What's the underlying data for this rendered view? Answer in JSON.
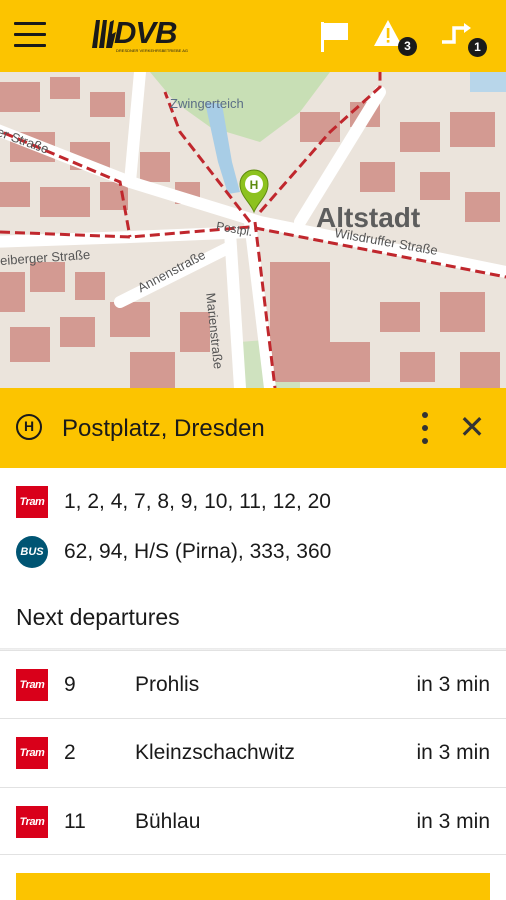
{
  "header": {
    "logo_text": "DVB",
    "logo_subtitle": "DRESDNER VERKEHRSBETRIEBE AG",
    "alerts_count": "3",
    "routes_count": "1"
  },
  "map": {
    "labels": {
      "district": "Altstadt",
      "zwingerteich": "Zwingerteich",
      "street_top_left": "er Straße",
      "postplatz": "Postpl.",
      "wilsdruffer": "Wilsdruffer Straße",
      "freiberger": "eiberger Straße",
      "annenstrasse": "Annenstraße",
      "marienstrasse": "Marienstraße"
    },
    "marker_letter": "H"
  },
  "stop": {
    "icon_letter": "H",
    "name": "Postplatz, Dresden"
  },
  "lines": [
    {
      "type": "tram",
      "badge": "Tram",
      "numbers": "1, 2, 4, 7, 8, 9, 10, 11, 12, 20"
    },
    {
      "type": "bus",
      "badge": "BUS",
      "numbers": "62, 94, H/S (Pirna), 333, 360"
    }
  ],
  "departures_title": "Next departures",
  "departures": [
    {
      "badge": "Tram",
      "line": "9",
      "destination": "Prohlis",
      "time": "in 3 min"
    },
    {
      "badge": "Tram",
      "line": "2",
      "destination": "Kleinzschachwitz",
      "time": "in 3 min"
    },
    {
      "badge": "Tram",
      "line": "11",
      "destination": "Bühlau",
      "time": "in 3 min"
    }
  ],
  "colors": {
    "brand_yellow": "#fcc400",
    "tram_red": "#d9001a",
    "bus_teal": "#005573",
    "marker_green": "#8dc21f"
  }
}
